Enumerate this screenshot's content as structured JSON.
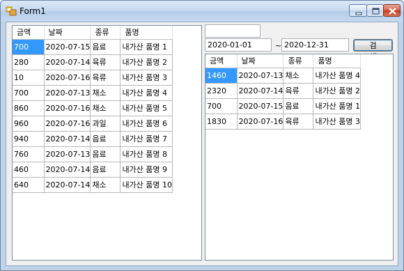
{
  "window": {
    "title": "Form1"
  },
  "left_grid": {
    "columns": [
      "금액",
      "날짜",
      "종류",
      "품명"
    ],
    "rows": [
      [
        "700",
        "2020-07-15",
        "음료",
        "내가산 품명 1"
      ],
      [
        "280",
        "2020-07-14",
        "육류",
        "내가산 품명 2"
      ],
      [
        "10",
        "2020-07-16",
        "육류",
        "내가산 품명 3"
      ],
      [
        "700",
        "2020-07-13",
        "채소",
        "내가산 품명 4"
      ],
      [
        "860",
        "2020-07-16",
        "채소",
        "내가산 품명 5"
      ],
      [
        "960",
        "2020-07-16",
        "과일",
        "내가산 품명 6"
      ],
      [
        "940",
        "2020-07-14",
        "음료",
        "내가산 품명 7"
      ],
      [
        "760",
        "2020-07-13",
        "음료",
        "내가산 품명 8"
      ],
      [
        "460",
        "2020-07-14",
        "음료",
        "내가산 품명 9"
      ],
      [
        "640",
        "2020-07-14",
        "채소",
        "내가산 품명 10"
      ]
    ]
  },
  "filter": {
    "top_textbox": "",
    "start_date": "2020-01-01",
    "separator": "~",
    "end_date": "2020-12-31",
    "search_label": "검 색"
  },
  "right_grid": {
    "columns": [
      "금액",
      "날짜",
      "종류",
      "품명"
    ],
    "rows": [
      [
        "1460",
        "2020-07-13",
        "채소",
        "내가산 품명 4"
      ],
      [
        "2320",
        "2020-07-14",
        "육류",
        "내가산 품명 2"
      ],
      [
        "700",
        "2020-07-15",
        "음료",
        "내가산 품명 1"
      ],
      [
        "1830",
        "2020-07-16",
        "육류",
        "내가산 품명 3"
      ]
    ]
  },
  "colors": {
    "selection": "#3399ff",
    "titlebar": "#c4d8ee",
    "close_button": "#c53b1c"
  }
}
